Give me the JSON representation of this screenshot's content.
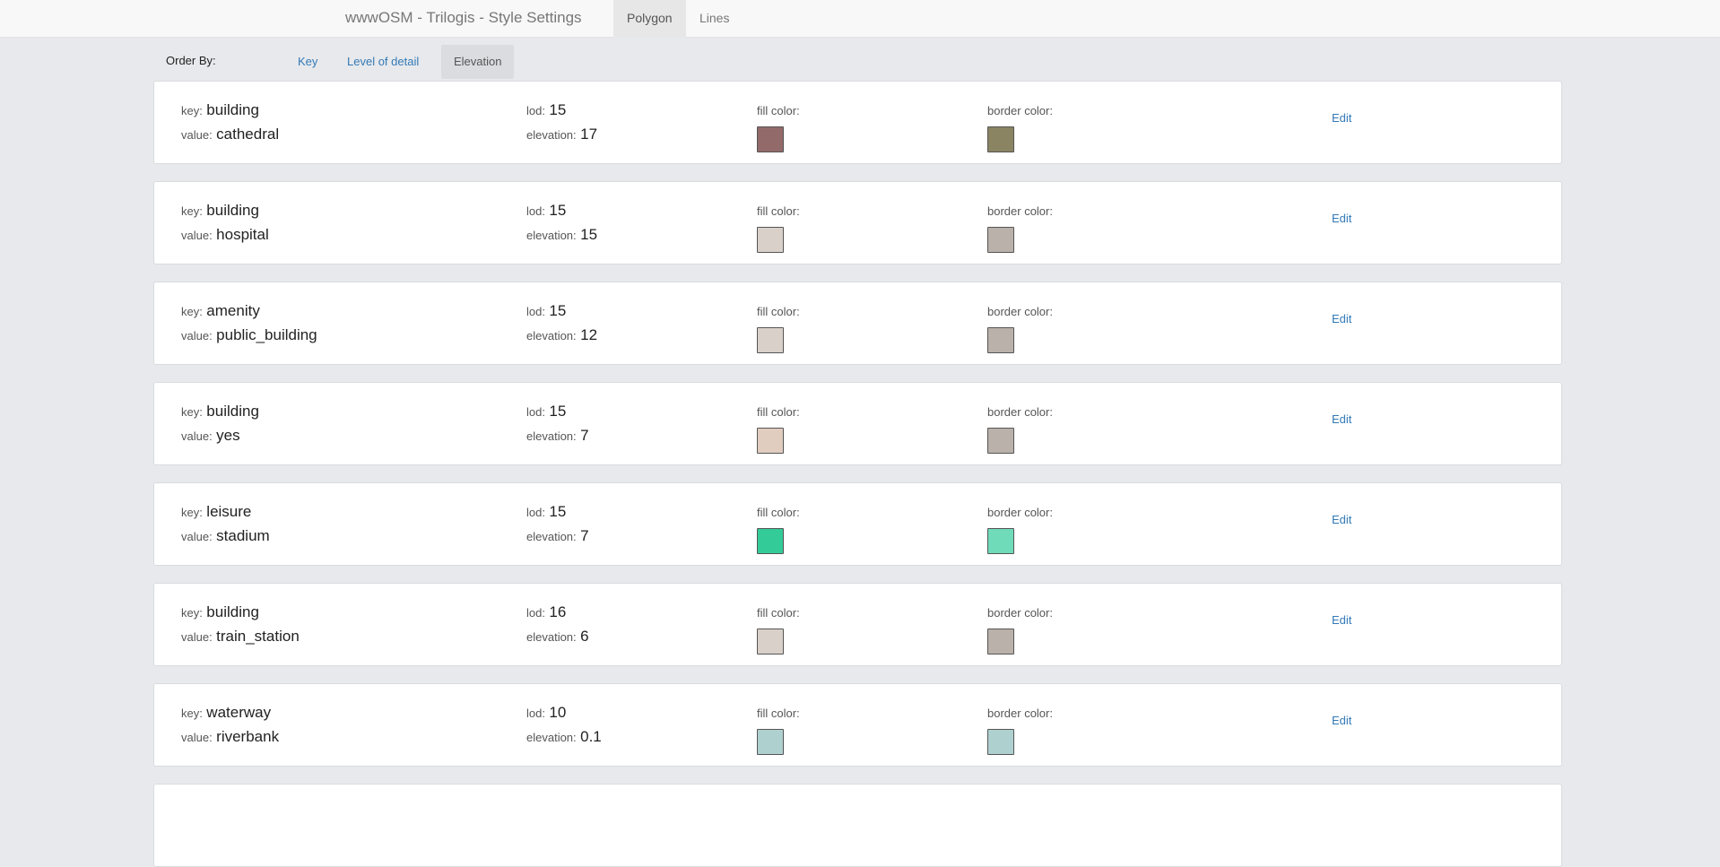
{
  "header": {
    "brand": "wwwOSM - Trilogis - Style Settings",
    "tabs": [
      {
        "label": "Polygon",
        "active": true
      },
      {
        "label": "Lines",
        "active": false
      }
    ]
  },
  "order_by": {
    "label": "Order By:",
    "options": [
      {
        "label": "Key",
        "active": false
      },
      {
        "label": "Level of detail",
        "active": false
      },
      {
        "label": "Elevation",
        "active": true
      }
    ]
  },
  "labels": {
    "key": "key:",
    "value": "value:",
    "lod": "lod:",
    "elevation": "elevation:",
    "fill": "fill color:",
    "border": "border color:",
    "edit": "Edit"
  },
  "items": [
    {
      "key": "building",
      "value": "cathedral",
      "lod": "15",
      "elevation": "17",
      "fill_color": "#936a6a",
      "border_color": "#8a8462"
    },
    {
      "key": "building",
      "value": "hospital",
      "lod": "15",
      "elevation": "15",
      "fill_color": "#d9d0c9",
      "border_color": "#b9b1aa"
    },
    {
      "key": "amenity",
      "value": "public_building",
      "lod": "15",
      "elevation": "12",
      "fill_color": "#d9d0c9",
      "border_color": "#b9b1aa"
    },
    {
      "key": "building",
      "value": "yes",
      "lod": "15",
      "elevation": "7",
      "fill_color": "#e1ccc0",
      "border_color": "#b9b1aa"
    },
    {
      "key": "leisure",
      "value": "stadium",
      "lod": "15",
      "elevation": "7",
      "fill_color": "#33cc99",
      "border_color": "#70dbb8"
    },
    {
      "key": "building",
      "value": "train_station",
      "lod": "16",
      "elevation": "6",
      "fill_color": "#d9d0c9",
      "border_color": "#b9b1aa"
    },
    {
      "key": "waterway",
      "value": "riverbank",
      "lod": "10",
      "elevation": "0.1",
      "fill_color": "#aed1d0",
      "border_color": "#aed1d0"
    },
    {
      "key": "",
      "value": "",
      "lod": "",
      "elevation": "",
      "fill_color": "#ffffff",
      "border_color": "#ffffff"
    }
  ]
}
